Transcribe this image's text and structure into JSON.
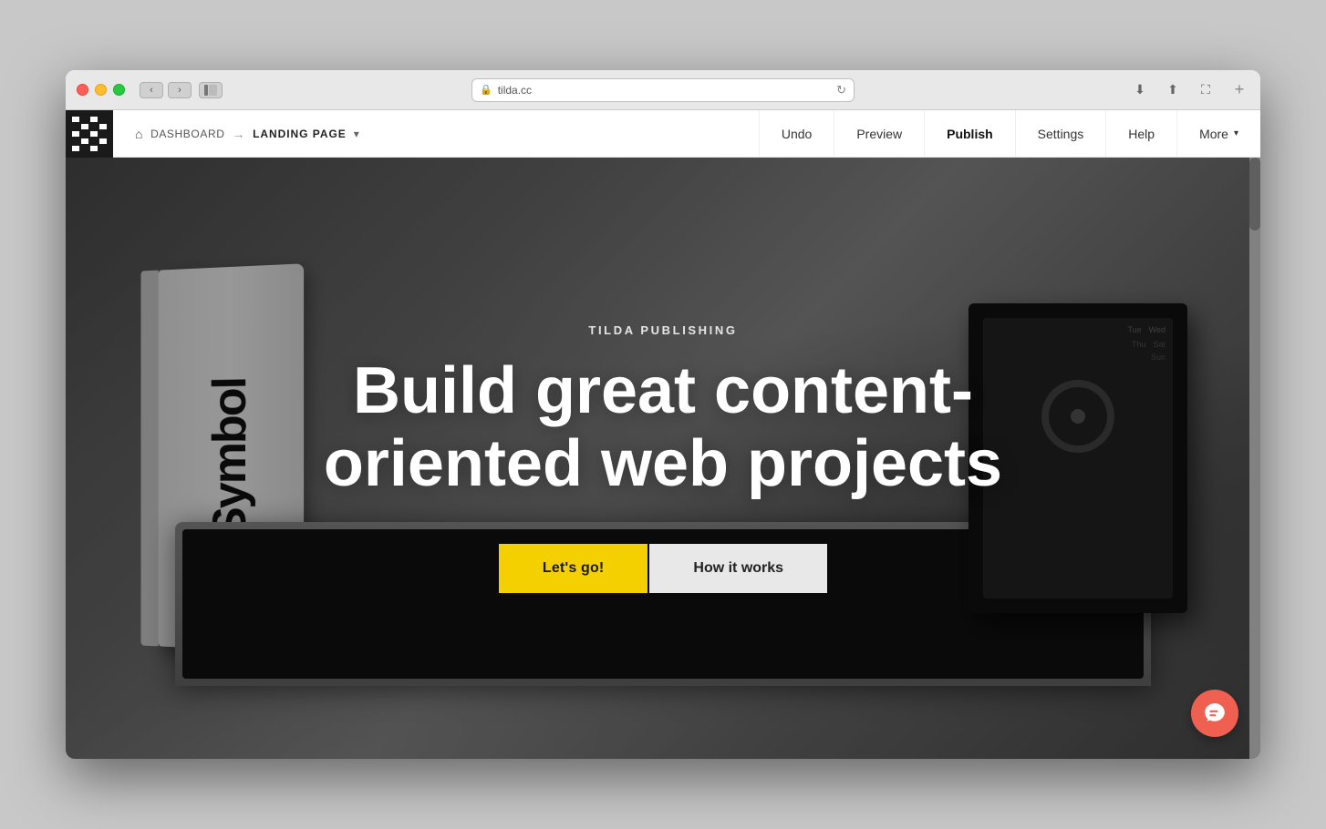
{
  "window": {
    "url": "tilda.cc",
    "traffic_lights": [
      "red",
      "yellow",
      "green"
    ]
  },
  "navbar": {
    "logo_alt": "Tilda",
    "breadcrumb": {
      "home_label": "DASHBOARD",
      "separator": "→",
      "current": "LANDING PAGE",
      "dropdown_label": "▾"
    },
    "actions": [
      {
        "id": "undo",
        "label": "Undo",
        "bold": false
      },
      {
        "id": "preview",
        "label": "Preview",
        "bold": false
      },
      {
        "id": "publish",
        "label": "Publish",
        "bold": true
      },
      {
        "id": "settings",
        "label": "Settings",
        "bold": false
      },
      {
        "id": "help",
        "label": "Help",
        "bold": false
      },
      {
        "id": "more",
        "label": "More",
        "bold": false,
        "has_arrow": true
      }
    ]
  },
  "hero": {
    "subtitle": "TILDA PUBLISHING",
    "title": "Build great content-oriented web projects",
    "buttons": [
      {
        "id": "cta-primary",
        "label": "Let's go!",
        "type": "primary"
      },
      {
        "id": "cta-secondary",
        "label": "How it works",
        "type": "secondary"
      }
    ]
  },
  "chat": {
    "icon_label": "chat-icon"
  },
  "colors": {
    "accent_yellow": "#f5d000",
    "accent_red": "#f06050",
    "navbar_bg": "#ffffff",
    "hero_overlay": "rgba(0,0,0,0.55)"
  }
}
